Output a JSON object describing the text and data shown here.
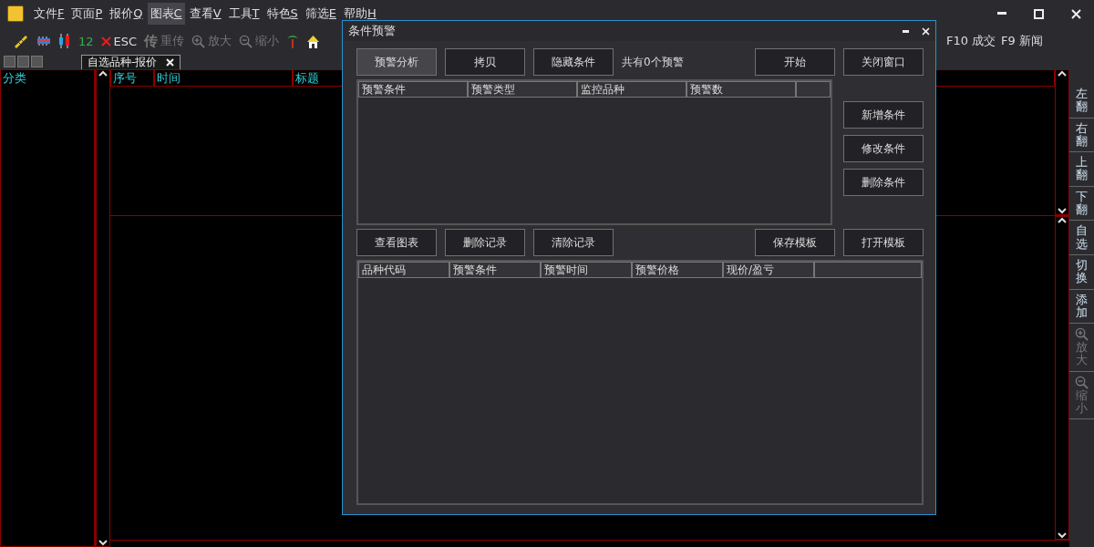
{
  "menu": [
    {
      "label": "文件",
      "key": "F",
      "selected": false
    },
    {
      "label": "页面",
      "key": "P",
      "selected": false
    },
    {
      "label": "报价",
      "key": "Q",
      "selected": false
    },
    {
      "label": "图表",
      "key": "C",
      "selected": true
    },
    {
      "label": "查看",
      "key": "V",
      "selected": false
    },
    {
      "label": "工具",
      "key": "T",
      "selected": false
    },
    {
      "label": "特色",
      "key": "S",
      "selected": false
    },
    {
      "label": "筛选",
      "key": "E",
      "selected": false
    },
    {
      "label": "帮助",
      "key": "H",
      "selected": false
    }
  ],
  "toolbar": [
    {
      "kind": "count",
      "label": "12",
      "disabled": false
    },
    {
      "kind": "cancel",
      "label": "ESC",
      "disabled": false
    },
    {
      "kind": "resend",
      "glyph": "传",
      "label": "重传",
      "disabled": true
    },
    {
      "kind": "zoom-in",
      "label": "放大",
      "disabled": true
    },
    {
      "kind": "zoom-out",
      "label": "缩小",
      "disabled": true
    }
  ],
  "toolbar_right": [
    "F10 成交",
    "F9 新闻"
  ],
  "tabs": [
    {
      "label": "自选品种-报价",
      "selected": true
    }
  ],
  "category_panel": {
    "header": "分类"
  },
  "quote_table": {
    "columns": [
      "序号",
      "时间",
      "标题"
    ]
  },
  "side_bar": [
    {
      "kind": "text",
      "label": "左翻",
      "disabled": false
    },
    {
      "kind": "text",
      "label": "右翻",
      "disabled": false
    },
    {
      "kind": "text",
      "label": "上翻",
      "disabled": false
    },
    {
      "kind": "text",
      "label": "下翻",
      "disabled": false
    },
    {
      "kind": "text",
      "label": "自选",
      "disabled": false
    },
    {
      "kind": "text",
      "label": "切换",
      "disabled": false
    },
    {
      "kind": "text",
      "label": "添加",
      "disabled": false
    },
    {
      "kind": "zoom-in",
      "label": "放大",
      "disabled": true
    },
    {
      "kind": "zoom-out",
      "label": "缩小",
      "disabled": true
    }
  ],
  "dialog": {
    "title": "条件预警",
    "top_buttons": [
      {
        "label": "预警分析",
        "selected": true
      },
      {
        "label": "拷贝",
        "selected": false
      },
      {
        "label": "隐藏条件",
        "selected": false
      }
    ],
    "alert_count": "共有0个预警",
    "action_buttons": [
      "开始",
      "关闭窗口"
    ],
    "condition_table": {
      "columns": [
        "预警条件",
        "预警类型",
        "监控品种",
        "预警数"
      ]
    },
    "condition_buttons": [
      "新增条件",
      "修改条件",
      "删除条件"
    ],
    "record_buttons": [
      "查看图表",
      "删除记录",
      "清除记录"
    ],
    "template_buttons": [
      "保存模板",
      "打开模板"
    ],
    "record_table": {
      "columns": [
        "品种代码",
        "预警条件",
        "预警时间",
        "预警价格",
        "现价/盈亏"
      ]
    }
  }
}
